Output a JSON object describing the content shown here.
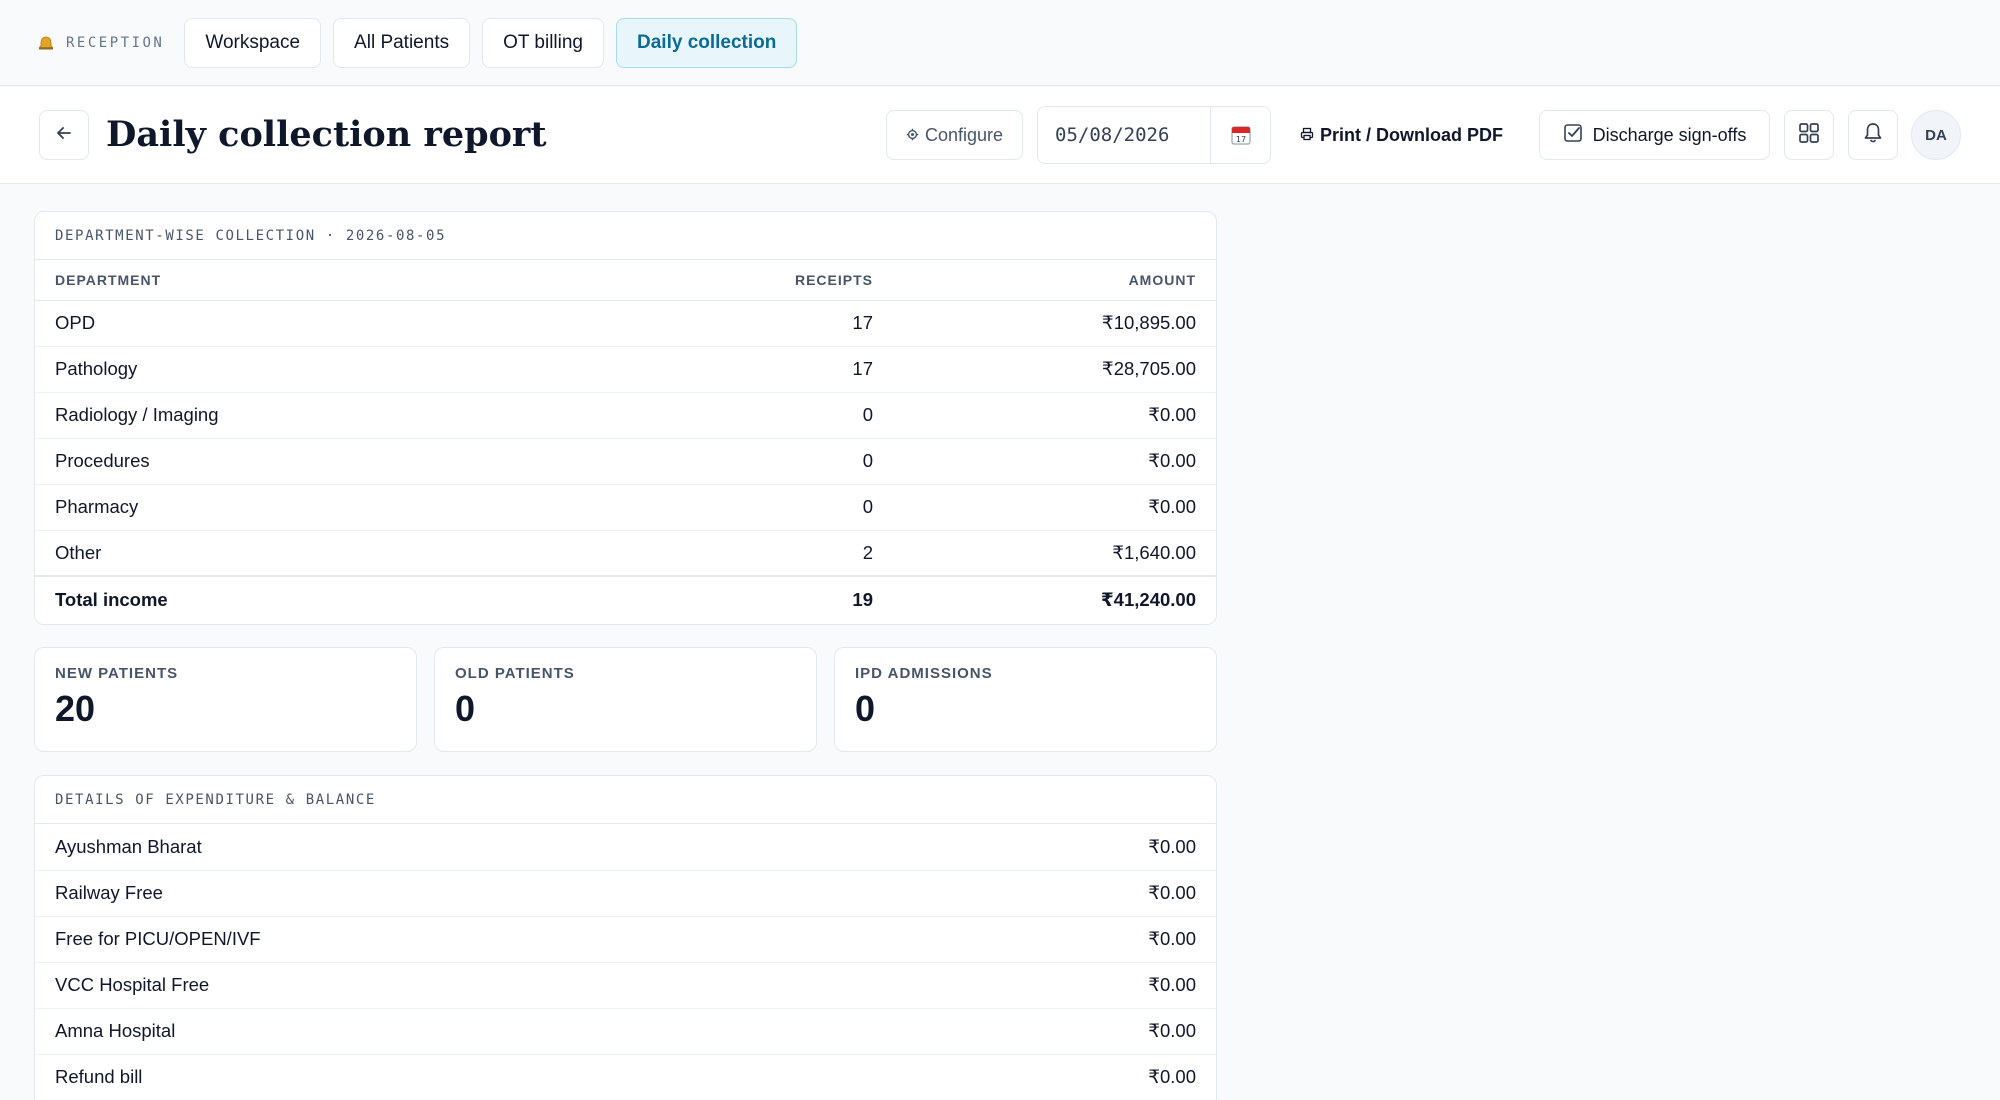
{
  "nav": {
    "brand_label": "RECEPTION",
    "tabs": [
      {
        "label": "Workspace"
      },
      {
        "label": "All Patients"
      },
      {
        "label": "OT billing"
      },
      {
        "label": "Daily collection"
      }
    ],
    "active_tab": "Daily collection"
  },
  "header": {
    "title": "Daily collection report",
    "configure_label": "Configure",
    "date_value": "05/08/2026",
    "print_label": "Print / Download PDF",
    "signoff_label": "Discharge sign-offs",
    "avatar_initials": "DA"
  },
  "department": {
    "caption": "DEPARTMENT-WISE COLLECTION · 2026-08-05",
    "columns": [
      "DEPARTMENT",
      "RECEIPTS",
      "AMOUNT"
    ],
    "rows": [
      {
        "department": "OPD",
        "receipts": "17",
        "amount": "₹10,895.00"
      },
      {
        "department": "Pathology",
        "receipts": "17",
        "amount": "₹28,705.00"
      },
      {
        "department": "Radiology / Imaging",
        "receipts": "0",
        "amount": "₹0.00"
      },
      {
        "department": "Procedures",
        "receipts": "0",
        "amount": "₹0.00"
      },
      {
        "department": "Pharmacy",
        "receipts": "0",
        "amount": "₹0.00"
      },
      {
        "department": "Other",
        "receipts": "2",
        "amount": "₹1,640.00"
      }
    ],
    "total": {
      "label": "Total income",
      "receipts": "19",
      "amount": "₹41,240.00"
    }
  },
  "stats": [
    {
      "label": "NEW PATIENTS",
      "value": "20"
    },
    {
      "label": "OLD PATIENTS",
      "value": "0"
    },
    {
      "label": "IPD ADMISSIONS",
      "value": "0"
    }
  ],
  "expenditure": {
    "caption": "DETAILS OF EXPENDITURE & BALANCE",
    "rows": [
      {
        "label": "Ayushman Bharat",
        "amount": "₹0.00"
      },
      {
        "label": "Railway Free",
        "amount": "₹0.00"
      },
      {
        "label": "Free for PICU/OPEN/IVF",
        "amount": "₹0.00"
      },
      {
        "label": "VCC Hospital Free",
        "amount": "₹0.00"
      },
      {
        "label": "Amna Hospital",
        "amount": "₹0.00"
      },
      {
        "label": "Refund bill",
        "amount": "₹0.00"
      }
    ]
  },
  "colors": {
    "accent": "#0b6b94",
    "accent_bg": "#e8f6fc",
    "border": "#e2e8f0",
    "text": "#0f172a",
    "muted": "#475569"
  },
  "icons": {
    "brand": "bell-icon",
    "back": "arrow-left-icon",
    "configure": "gear-icon",
    "calendar": "calendar-icon",
    "print": "printer-icon",
    "signoff": "checkbox-icon",
    "apps": "grid-icon",
    "notifications": "bell-icon"
  }
}
